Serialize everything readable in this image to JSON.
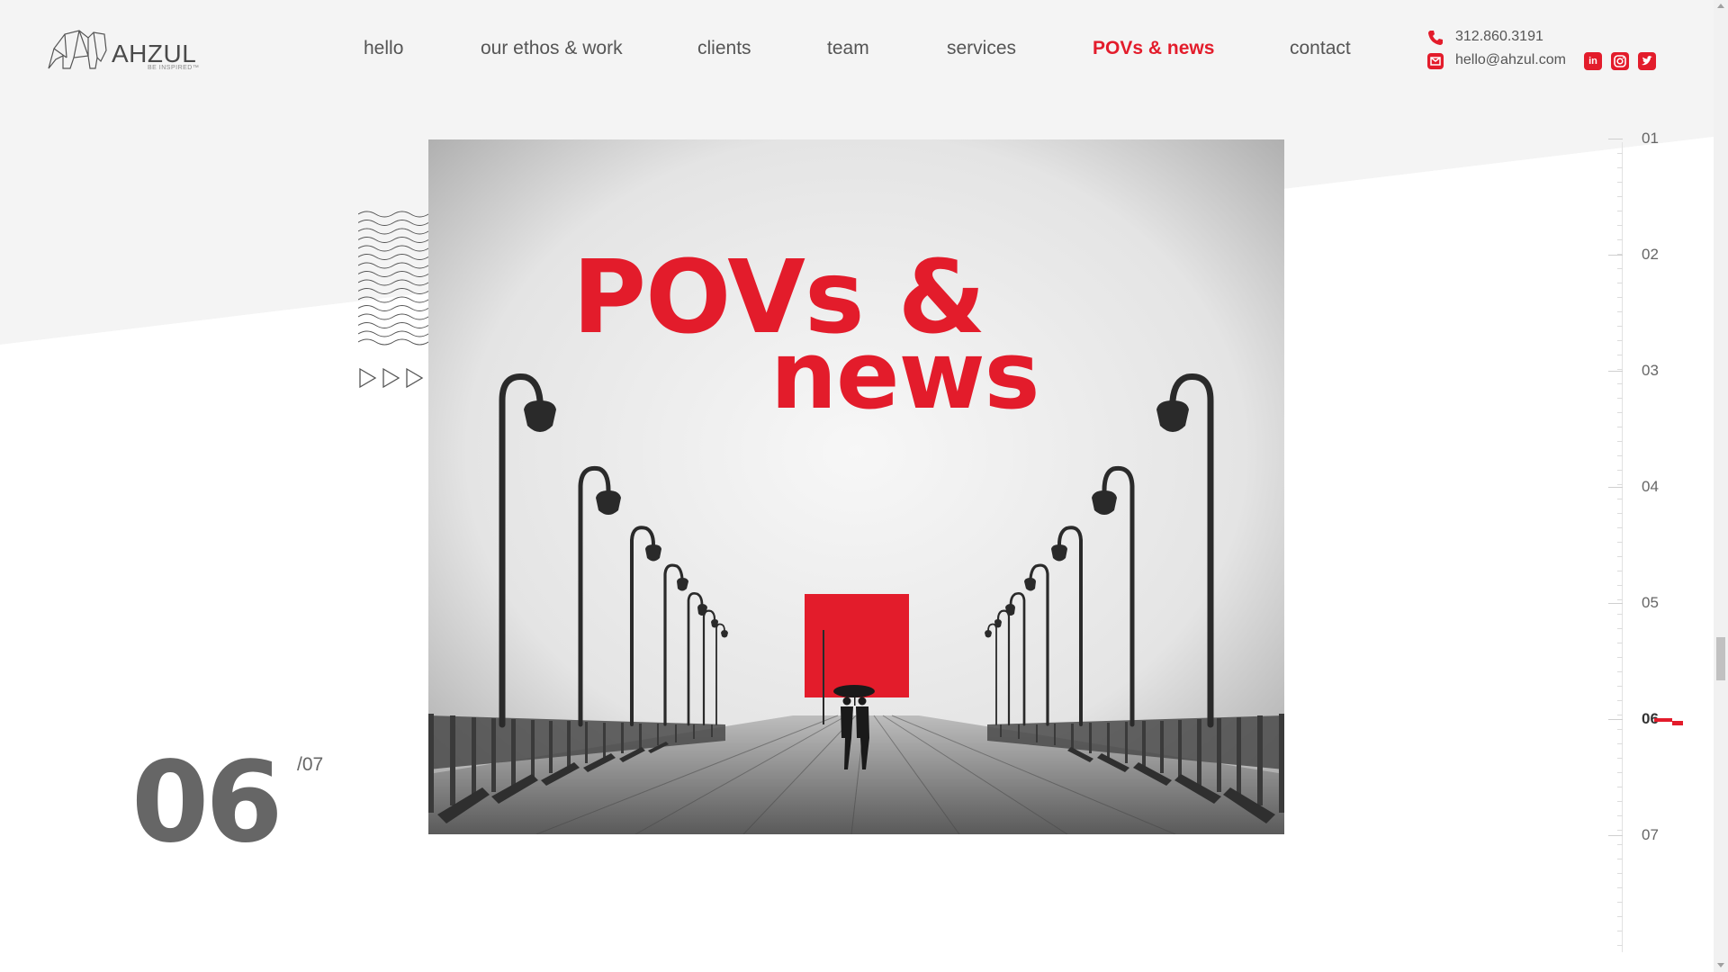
{
  "brand": {
    "name": "AHZUL",
    "tagline": "BE INSPIRED™"
  },
  "nav": {
    "items": [
      {
        "label": "hello"
      },
      {
        "label": "our ethos & work"
      },
      {
        "label": "clients"
      },
      {
        "label": "team"
      },
      {
        "label": "services"
      },
      {
        "label": "POVs & news",
        "active": true
      },
      {
        "label": "contact"
      }
    ]
  },
  "contact": {
    "phone": "312.860.3191",
    "email": "hello@ahzul.com"
  },
  "social": [
    "linkedin-icon",
    "instagram-icon",
    "twitter-icon"
  ],
  "hero": {
    "title_line1": "POVs &",
    "title_line2": "news"
  },
  "counter": {
    "current": "06",
    "total": "/07"
  },
  "pager": {
    "items": [
      "01",
      "02",
      "03",
      "04",
      "05",
      "06",
      "07"
    ],
    "active_index": 5
  },
  "colors": {
    "accent": "#e31c2b",
    "text": "#555555",
    "background": "#f4f4f4"
  }
}
